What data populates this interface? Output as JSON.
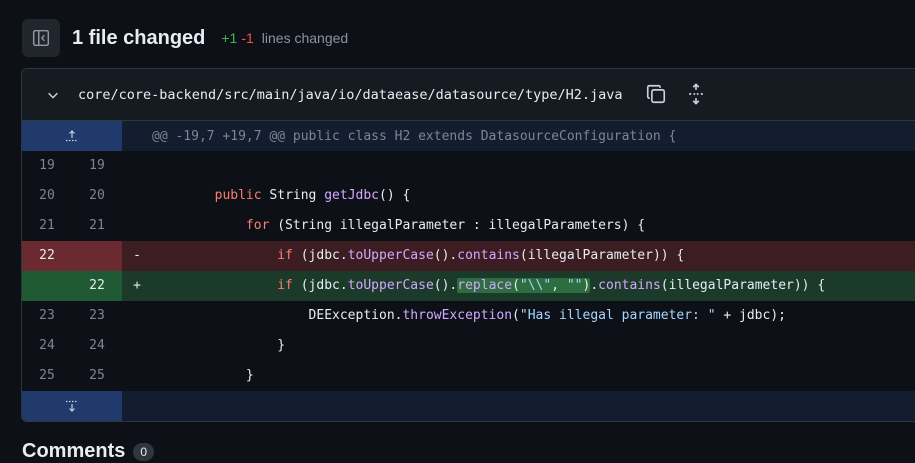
{
  "summary": {
    "files_changed": "1 file changed",
    "additions": "+1",
    "deletions": "-1",
    "lines_changed_label": "lines changed"
  },
  "file": {
    "path": "core/core-backend/src/main/java/io/dataease/datasource/type/H2.java",
    "hunk_header": "@@ -19,7 +19,7 @@ public class H2 extends DatasourceConfiguration {"
  },
  "lines": [
    {
      "old": "19",
      "new": "19",
      "marker": "",
      "type": "context"
    },
    {
      "old": "20",
      "new": "20",
      "marker": "",
      "type": "context"
    },
    {
      "old": "21",
      "new": "21",
      "marker": "",
      "type": "context"
    },
    {
      "old": "22",
      "new": "",
      "marker": "-",
      "type": "del"
    },
    {
      "old": "",
      "new": "22",
      "marker": "+",
      "type": "add"
    },
    {
      "old": "23",
      "new": "23",
      "marker": "",
      "type": "context"
    },
    {
      "old": "24",
      "new": "24",
      "marker": "",
      "type": "context"
    },
    {
      "old": "25",
      "new": "25",
      "marker": "",
      "type": "context"
    }
  ],
  "code": {
    "l20_kw": "public",
    "l20_type": " String ",
    "l20_fn": "getJdbc",
    "l20_rest": "() {",
    "l21_kw": "for",
    "l21_rest": " (String illegalParameter : illegalParameters) {",
    "l22_kw": "if",
    "l22_a": " (jdbc.",
    "l22_fn1": "toUpperCase",
    "l22_b": "().",
    "l22_fn2": "contains",
    "l22_c": "(illegalParameter)) {",
    "l22n_kw": "if",
    "l22n_a": " (jdbc.",
    "l22n_fn1": "toUpperCase",
    "l22n_b": "().",
    "l22n_hl_fn": "replace",
    "l22n_hl_a": "(",
    "l22n_hl_s1": "\"\\\\\"",
    "l22n_hl_b": ", ",
    "l22n_hl_s2": "\"\"",
    "l22n_hl_c": ")",
    "l22n_c": ".",
    "l22n_fn2": "contains",
    "l22n_d": "(illegalParameter)) {",
    "l23_a": "DEException.",
    "l23_fn": "throwException",
    "l23_b": "(",
    "l23_str": "\"Has illegal parameter: \"",
    "l23_c": " + jdbc);",
    "l24": "}",
    "l25": "}"
  },
  "comments": {
    "title": "Comments",
    "count": "0"
  },
  "icons": {
    "toggle": "sidebar-toggle-icon",
    "chevron": "chevron-down-icon",
    "copy": "copy-icon",
    "expand": "unfold-icon",
    "expand_up": "expand-up-icon",
    "expand_down": "expand-down-icon"
  },
  "colors": {
    "background": "#0d1117",
    "addition": "#3fb950",
    "deletion": "#f85149",
    "keyword": "#ff7b72",
    "function": "#d2a8ff",
    "string": "#a5d6ff"
  }
}
